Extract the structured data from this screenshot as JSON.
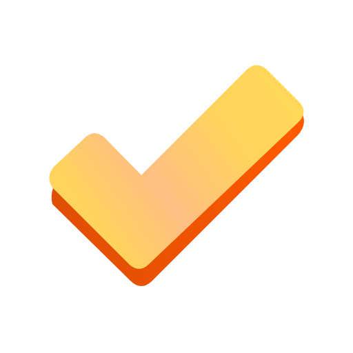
{
  "icon": {
    "name": "checkmark-icon",
    "colors": {
      "background": "#ffffff",
      "face_light": "#FFD957",
      "face_peach": "#FFBE83",
      "shadow_dark": "#E04E05",
      "shadow_bright": "#FF5A00"
    }
  }
}
